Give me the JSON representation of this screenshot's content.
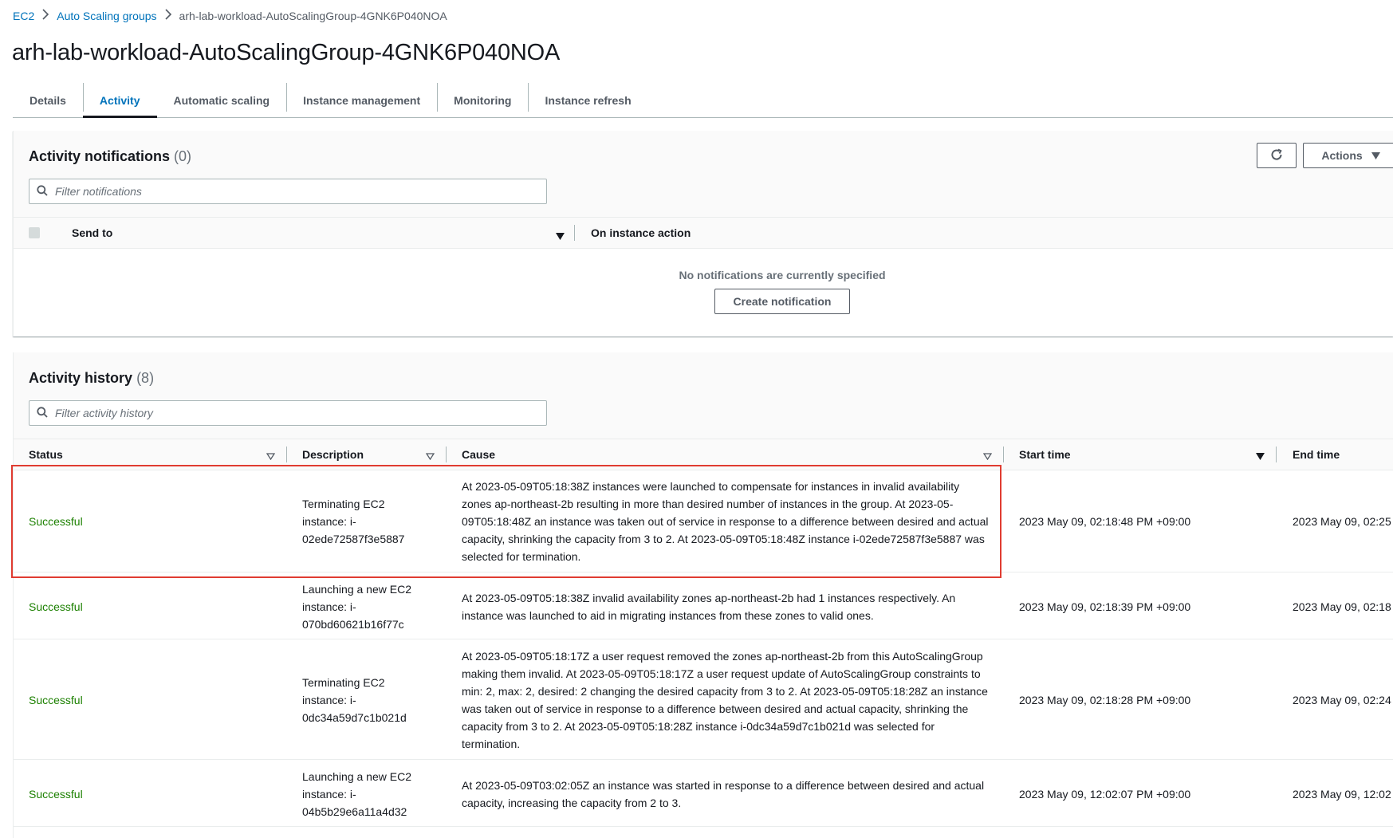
{
  "breadcrumb": {
    "items": [
      {
        "label": "EC2"
      },
      {
        "label": "Auto Scaling groups"
      },
      {
        "label": "arh-lab-workload-AutoScalingGroup-4GNK6P040NOA"
      }
    ]
  },
  "page": {
    "title": "arh-lab-workload-AutoScalingGroup-4GNK6P040NOA"
  },
  "tabs": [
    {
      "label": "Details"
    },
    {
      "label": "Activity",
      "active": true
    },
    {
      "label": "Automatic scaling"
    },
    {
      "label": "Instance management"
    },
    {
      "label": "Monitoring"
    },
    {
      "label": "Instance refresh"
    }
  ],
  "notifications": {
    "title": "Activity notifications",
    "count": "(0)",
    "refresh_icon": "refresh-icon",
    "actions_label": "Actions",
    "search_placeholder": "Filter notifications",
    "columns": {
      "send_to": "Send to",
      "on_instance_action": "On instance action"
    },
    "empty_text": "No notifications are currently specified",
    "create_label": "Create notification"
  },
  "history": {
    "title": "Activity history",
    "count": "(8)",
    "search_placeholder": "Filter activity history",
    "columns": {
      "status": "Status",
      "description": "Description",
      "cause": "Cause",
      "start_time": "Start time",
      "end_time": "End time"
    },
    "rows": [
      {
        "status": "Successful",
        "description": "Terminating EC2 instance: i-02ede72587f3e5887",
        "cause": "At 2023-05-09T05:18:38Z instances were launched to compensate for instances in invalid availability zones ap-northeast-2b resulting in more than desired number of instances in the group. At 2023-05-09T05:18:48Z an instance was taken out of service in response to a difference between desired and actual capacity, shrinking the capacity from 3 to 2. At 2023-05-09T05:18:48Z instance i-02ede72587f3e5887 was selected for termination.",
        "start_time": "2023 May 09, 02:18:48 PM +09:00",
        "end_time": "2023 May 09, 02:25"
      },
      {
        "status": "Successful",
        "description": "Launching a new EC2 instance: i-070bd60621b16f77c",
        "cause": "At 2023-05-09T05:18:38Z invalid availability zones ap-northeast-2b had 1 instances respectively. An instance was launched to aid in migrating instances from these zones to valid ones.",
        "start_time": "2023 May 09, 02:18:39 PM +09:00",
        "end_time": "2023 May 09, 02:18"
      },
      {
        "status": "Successful",
        "description": "Terminating EC2 instance: i-0dc34a59d7c1b021d",
        "cause": "At 2023-05-09T05:18:17Z a user request removed the zones ap-northeast-2b from this AutoScalingGroup making them invalid. At 2023-05-09T05:18:17Z a user request update of AutoScalingGroup constraints to min: 2, max: 2, desired: 2 changing the desired capacity from 3 to 2. At 2023-05-09T05:18:28Z an instance was taken out of service in response to a difference between desired and actual capacity, shrinking the capacity from 3 to 2. At 2023-05-09T05:18:28Z instance i-0dc34a59d7c1b021d was selected for termination.",
        "start_time": "2023 May 09, 02:18:28 PM +09:00",
        "end_time": "2023 May 09, 02:24"
      },
      {
        "status": "Successful",
        "description": "Launching a new EC2 instance: i-04b5b29e6a11a4d32",
        "cause": "At 2023-05-09T03:02:05Z an instance was started in response to a difference between desired and actual capacity, increasing the capacity from 2 to 3.",
        "start_time": "2023 May 09, 12:02:07 PM +09:00",
        "end_time": "2023 May 09, 12:02"
      }
    ]
  },
  "colors": {
    "link": "#0073bb",
    "success": "#1d8102",
    "highlight": "#e03c31"
  }
}
